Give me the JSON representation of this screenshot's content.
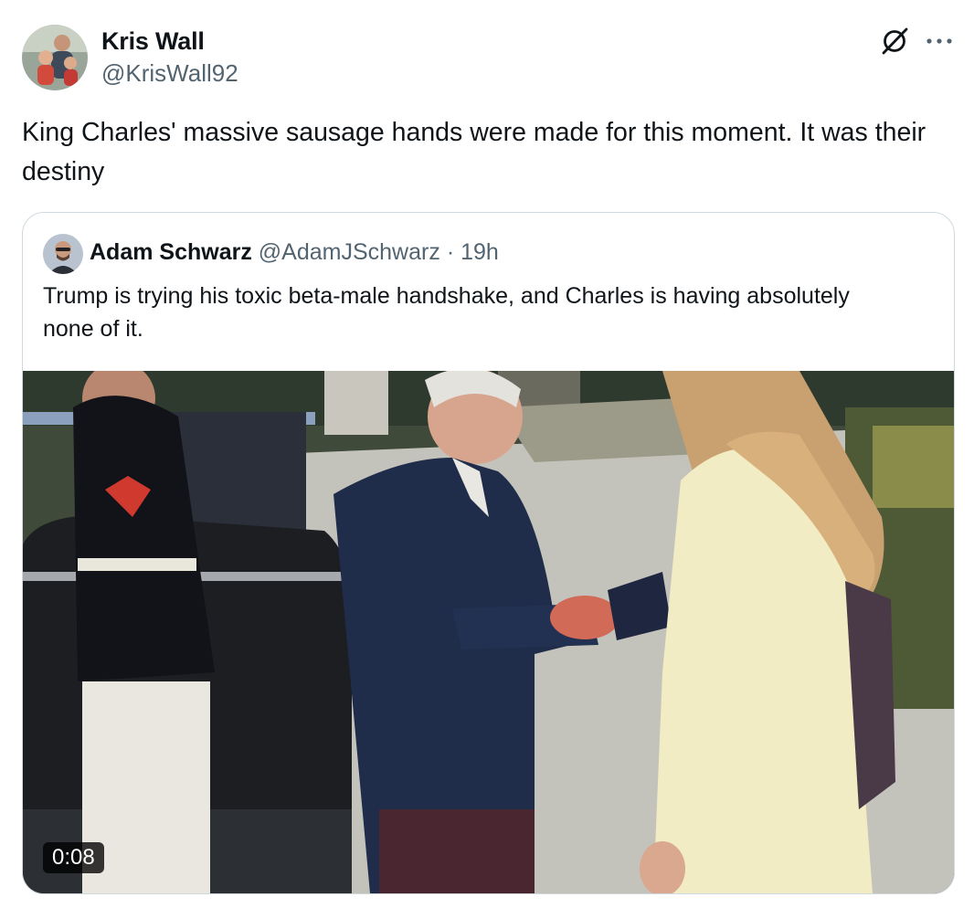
{
  "author": {
    "name": "Kris Wall",
    "handle": "@KrisWall92"
  },
  "icons": {
    "grok": "grok-icon",
    "more": "more-icon"
  },
  "tweet_text": "King Charles' massive sausage hands were made for this moment. It was their destiny",
  "quote": {
    "name": "Adam Schwarz",
    "handle": "@AdamJSchwarz",
    "separator": "·",
    "time": "19h",
    "text": "Trump is trying his toxic beta-male handshake, and Charles is having absolutely none of it.",
    "video_duration": "0:08"
  }
}
